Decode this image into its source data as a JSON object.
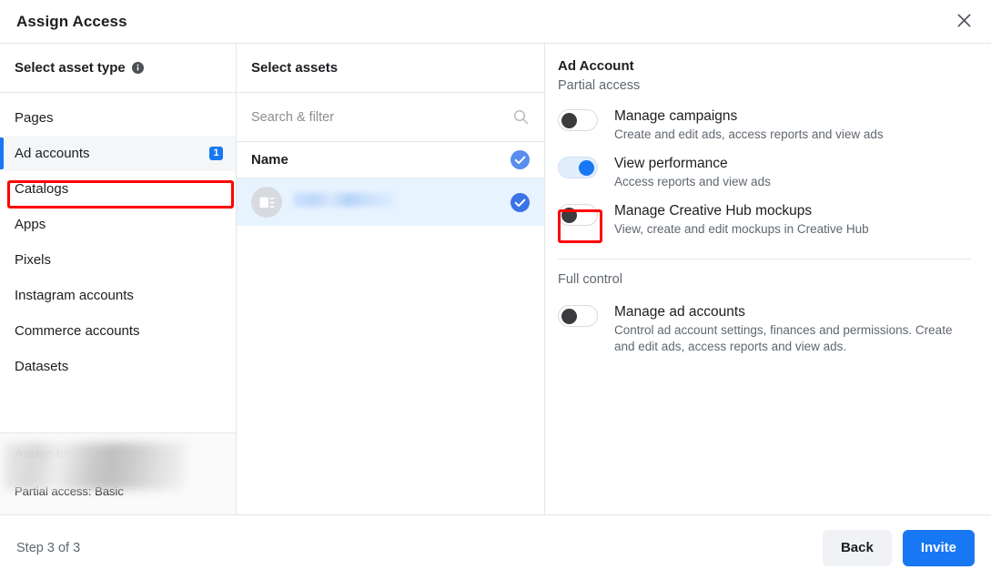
{
  "dialog": {
    "title": "Assign Access",
    "close_icon": "close-icon"
  },
  "left_column": {
    "header": "Select asset type",
    "info_icon": "info-icon",
    "items": [
      {
        "label": "Pages",
        "selected": false,
        "badge": ""
      },
      {
        "label": "Ad accounts",
        "selected": true,
        "badge": "1"
      },
      {
        "label": "Catalogs",
        "selected": false,
        "badge": ""
      },
      {
        "label": "Apps",
        "selected": false,
        "badge": ""
      },
      {
        "label": "Pixels",
        "selected": false,
        "badge": ""
      },
      {
        "label": "Instagram accounts",
        "selected": false,
        "badge": ""
      },
      {
        "label": "Commerce accounts",
        "selected": false,
        "badge": ""
      },
      {
        "label": "Datasets",
        "selected": false,
        "badge": ""
      }
    ],
    "assign_to": {
      "title": "Assign to",
      "subtitle": "Partial access: Basic",
      "redacted": true
    }
  },
  "middle_column": {
    "header": "Select assets",
    "search": {
      "placeholder": "Search & filter",
      "value": "",
      "icon": "search-icon"
    },
    "list_header": {
      "label": "Name",
      "checked": true,
      "check_icon": "check-circle-icon"
    },
    "rows": [
      {
        "name": "",
        "redacted": true,
        "checked": true,
        "avatar_icon": "ad-account-icon",
        "check_icon": "check-circle-icon"
      }
    ]
  },
  "right_column": {
    "title": "Ad Account",
    "groups": [
      {
        "label": "Partial access",
        "permissions": [
          {
            "name": "Manage campaigns",
            "description": "Create and edit ads, access reports and view ads",
            "enabled": false
          },
          {
            "name": "View performance",
            "description": "Access reports and view ads",
            "enabled": true
          },
          {
            "name": "Manage Creative Hub mockups",
            "description": "View, create and edit mockups in Creative Hub",
            "enabled": false
          }
        ]
      },
      {
        "label": "Full control",
        "permissions": [
          {
            "name": "Manage ad accounts",
            "description": "Control ad account settings, finances and permissions. Create and edit ads, access reports and view ads.",
            "enabled": false
          }
        ]
      }
    ]
  },
  "footer": {
    "step_text": "Step 3 of 3",
    "back_label": "Back",
    "invite_label": "Invite"
  },
  "annotations": [
    {
      "name": "ad-accounts-highlight",
      "color": "#ff0000"
    },
    {
      "name": "view-performance-highlight",
      "color": "#ff0000"
    }
  ],
  "colors": {
    "accent": "#1877f2",
    "selected_row_bg": "#e7f3ff",
    "annotation": "#ff0000",
    "text_primary": "#1c1e21",
    "text_secondary": "#606770"
  }
}
